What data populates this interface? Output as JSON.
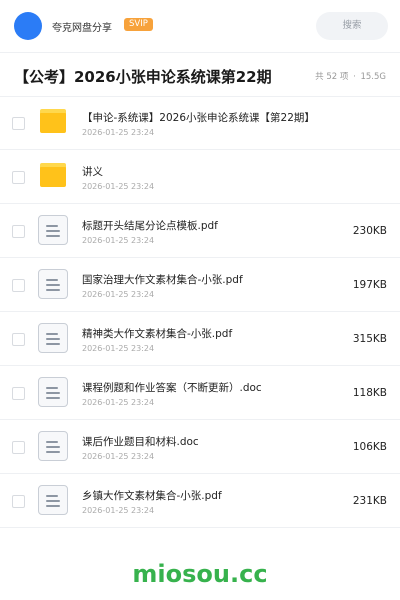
{
  "header": {
    "share_name": "夸克网盘分享",
    "badge": "SVIP",
    "search_label": "搜索",
    "accent_color": "#2b7cf6"
  },
  "folder": {
    "title": "【公考】2026小张申论系统课第22期",
    "count": "共 52 项",
    "separator": "·",
    "size": "15.5G"
  },
  "files": [
    {
      "icon": "folder-icon",
      "name": "【申论-系统课】2026小张申论系统课【第22期】",
      "date": "2026-01-25 23:24",
      "size": ""
    },
    {
      "icon": "folder-icon",
      "name": "讲义",
      "date": "2026-01-25 23:24",
      "size": ""
    },
    {
      "icon": "document-icon",
      "name": "标题开头结尾分论点模板.pdf",
      "date": "2026-01-25 23:24",
      "size": "230KB"
    },
    {
      "icon": "document-icon",
      "name": "国家治理大作文素材集合-小张.pdf",
      "date": "2026-01-25 23:24",
      "size": "197KB"
    },
    {
      "icon": "document-icon",
      "name": "精神类大作文素材集合-小张.pdf",
      "date": "2026-01-25 23:24",
      "size": "315KB"
    },
    {
      "icon": "document-icon",
      "name": "课程例题和作业答案（不断更新）.doc",
      "date": "2026-01-25 23:24",
      "size": "118KB"
    },
    {
      "icon": "document-icon",
      "name": "课后作业题目和材料.doc",
      "date": "2026-01-25 23:24",
      "size": "106KB"
    },
    {
      "icon": "document-icon",
      "name": "乡镇大作文素材集合-小张.pdf",
      "date": "2026-01-25 23:24",
      "size": "231KB"
    }
  ],
  "watermark": "miosou.cc"
}
